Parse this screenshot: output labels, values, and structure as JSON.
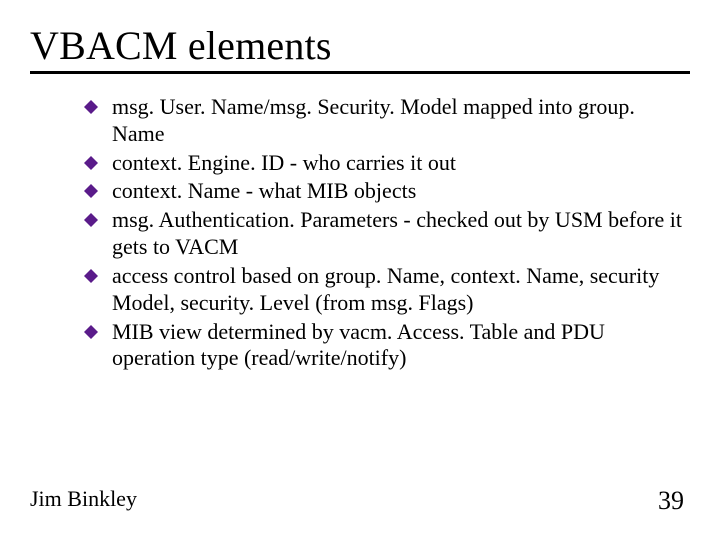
{
  "title": "VBACM elements",
  "bullets": [
    "msg. User. Name/msg. Security. Model mapped into group. Name",
    "context. Engine. ID - who carries it out",
    "context. Name - what MIB objects",
    "msg. Authentication. Parameters - checked out by USM before it gets to VACM",
    "access control based on group. Name, context. Name, security Model, security. Level (from msg. Flags)",
    "MIB view determined by vacm. Access. Table and PDU operation type (read/write/notify)"
  ],
  "footer": {
    "author": "Jim Binkley",
    "page": "39"
  }
}
